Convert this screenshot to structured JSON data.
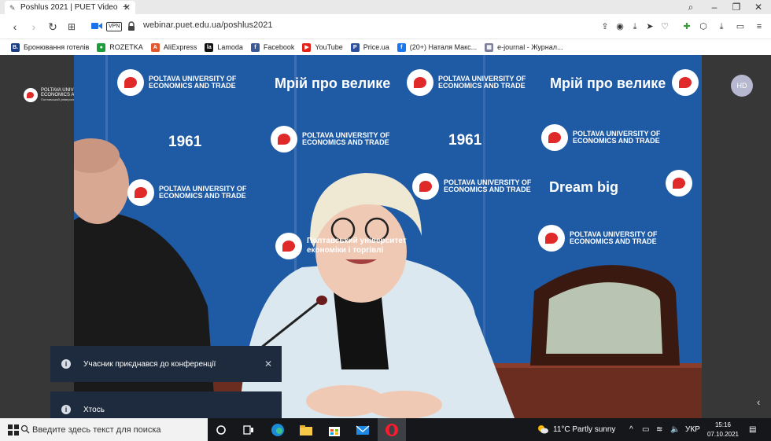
{
  "browser": {
    "tab_title": "Poshlus 2021 | PUET Video",
    "url": "webinar.puet.edu.ua/poshlus2021",
    "vpn_label": "VPN"
  },
  "bookmarks": [
    {
      "label": "Бронювання готелів",
      "color": "#1b3d86",
      "glyph": "B."
    },
    {
      "label": "ROZETKA",
      "color": "#1c9d3c",
      "glyph": "●"
    },
    {
      "label": "AliExpress",
      "color": "#e4572e",
      "glyph": "A"
    },
    {
      "label": "Lamoda",
      "color": "#111111",
      "glyph": "la"
    },
    {
      "label": "Facebook",
      "color": "#3b5998",
      "glyph": "f"
    },
    {
      "label": "YouTube",
      "color": "#e62117",
      "glyph": "▶"
    },
    {
      "label": "Price.ua",
      "color": "#2d4f9e",
      "glyph": "P"
    },
    {
      "label": "(20+) Наталя Макс...",
      "color": "#1877f2",
      "glyph": "f"
    },
    {
      "label": "e-journal - Журнал...",
      "color": "#7d7d9c",
      "glyph": "▦"
    }
  ],
  "video": {
    "hd_badge": "HD",
    "brand_line1": "POLTAVA UNIVERSITY OF",
    "brand_line2": "ECONOMICS AND TRADE",
    "slogan_ua": "Мрій про велике",
    "slogan_en": "Dream big",
    "year": "1961",
    "ua_name_line1": "Полтавський університет",
    "ua_name_line2": "економіки і торгівлі",
    "corner_line1": "POLTAVA UNIVERSITY OF",
    "corner_line2": "ECONOMICS AND TRADE",
    "corner_line3": "Полтавський університет економіки і торгівлі"
  },
  "notifications": [
    {
      "text": "Учасник приєднався до конференції",
      "closable": true
    },
    {
      "text": "Хтось",
      "closable": false
    }
  ],
  "taskbar": {
    "search_placeholder": "Введите здесь текст для поиска",
    "weather": "11°C  Partly sunny",
    "language": "УКР",
    "time": "15:16",
    "date": "07.10.2021"
  }
}
